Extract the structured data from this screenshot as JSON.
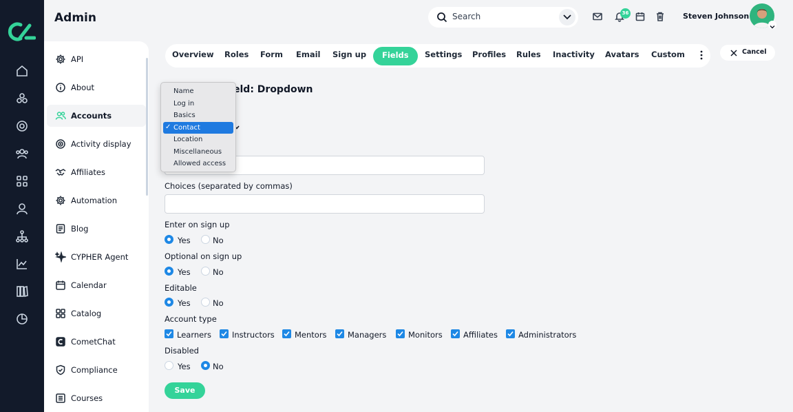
{
  "header": {
    "title": "Admin",
    "search_placeholder": "Search",
    "notification_count": "36",
    "user_name": "Steven Johnson"
  },
  "sidebar": {
    "items": [
      {
        "label": "API",
        "icon": "gear-icon"
      },
      {
        "label": "About",
        "icon": "info-icon"
      },
      {
        "label": "Accounts",
        "icon": "users-icon",
        "active": true
      },
      {
        "label": "Activity display",
        "icon": "target-icon"
      },
      {
        "label": "Affiliates",
        "icon": "handshake-icon"
      },
      {
        "label": "Automation",
        "icon": "gear-icon"
      },
      {
        "label": "Blog",
        "icon": "document-icon"
      },
      {
        "label": "CYPHER Agent",
        "icon": "sparkle-icon"
      },
      {
        "label": "Calendar",
        "icon": "calendar-icon"
      },
      {
        "label": "Catalog",
        "icon": "grid-icon"
      },
      {
        "label": "CometChat",
        "icon": "cometchat-icon"
      },
      {
        "label": "Compliance",
        "icon": "shield-icon"
      },
      {
        "label": "Courses",
        "icon": "list-icon"
      }
    ]
  },
  "tabs": [
    {
      "label": "Overview"
    },
    {
      "label": "Roles"
    },
    {
      "label": "Form"
    },
    {
      "label": "Email"
    },
    {
      "label": "Sign up"
    },
    {
      "label": "Fields",
      "active": true
    },
    {
      "label": "Settings"
    },
    {
      "label": "Profiles"
    },
    {
      "label": "Rules"
    },
    {
      "label": "Inactivity"
    },
    {
      "label": "Avatars"
    },
    {
      "label": "Custom"
    }
  ],
  "cancel_label": "Cancel",
  "form": {
    "title_visible": "eld: Dropdown",
    "dropdown_options": [
      {
        "label": "Name"
      },
      {
        "label": "Log in"
      },
      {
        "label": "Basics"
      },
      {
        "label": "Contact",
        "selected": true
      },
      {
        "label": "Location"
      },
      {
        "label": "Miscellaneous"
      },
      {
        "label": "Allowed access"
      }
    ],
    "name_value": "",
    "choices_label": "Choices (separated by commas)",
    "choices_value": "",
    "enter_on_signup": {
      "label": "Enter on sign up",
      "value": "Yes"
    },
    "optional_on_signup": {
      "label": "Optional on sign up",
      "value": "Yes"
    },
    "editable": {
      "label": "Editable",
      "value": "Yes"
    },
    "account_type": {
      "label": "Account type",
      "options": [
        "Learners",
        "Instructors",
        "Mentors",
        "Managers",
        "Monitors",
        "Affiliates",
        "Administrators"
      ],
      "checked": [
        true,
        true,
        true,
        true,
        true,
        true,
        true
      ]
    },
    "disabled": {
      "label": "Disabled",
      "value": "No"
    },
    "yes_label": "Yes",
    "no_label": "No",
    "save_label": "Save"
  },
  "colors": {
    "accent": "#34d399",
    "rail": "#121a2a",
    "checkbox": "#1e88e5",
    "dropdown_selected": "#1f7ae0"
  }
}
